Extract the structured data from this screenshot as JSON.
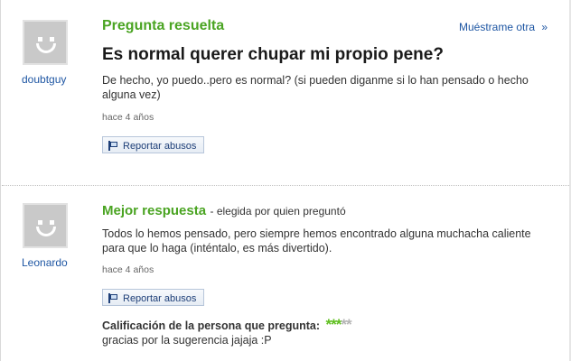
{
  "question": {
    "status_heading": "Pregunta resuelta",
    "more_link": "Muéstrame otra",
    "more_link_arrow": "»",
    "title": "Es normal querer chupar mi propio pene?",
    "body": "De hecho, yo puedo..pero es normal? (si pueden diganme si lo han pensado o hecho alguna vez)",
    "timestamp": "hace 4 años",
    "report_label": "Reportar abusos",
    "username": "doubtguy"
  },
  "best_answer": {
    "heading": "Mejor respuesta",
    "chosen_by": "- elegida por quien preguntó",
    "body": "Todos lo hemos pensado, pero siempre hemos encontrado alguna muchacha caliente para que lo haga (inténtalo, es más divertido).",
    "timestamp": "hace 4 años",
    "report_label": "Reportar abusos",
    "username": "Leonardo",
    "rating_label": "Calificación de la persona que pregunta:",
    "rating": {
      "filled": 3,
      "max": 5,
      "filled_color": "#5fbf1f",
      "empty_color": "#b5b5b5"
    },
    "rating_comment": "gracias por la sugerencia jajaja :P"
  }
}
